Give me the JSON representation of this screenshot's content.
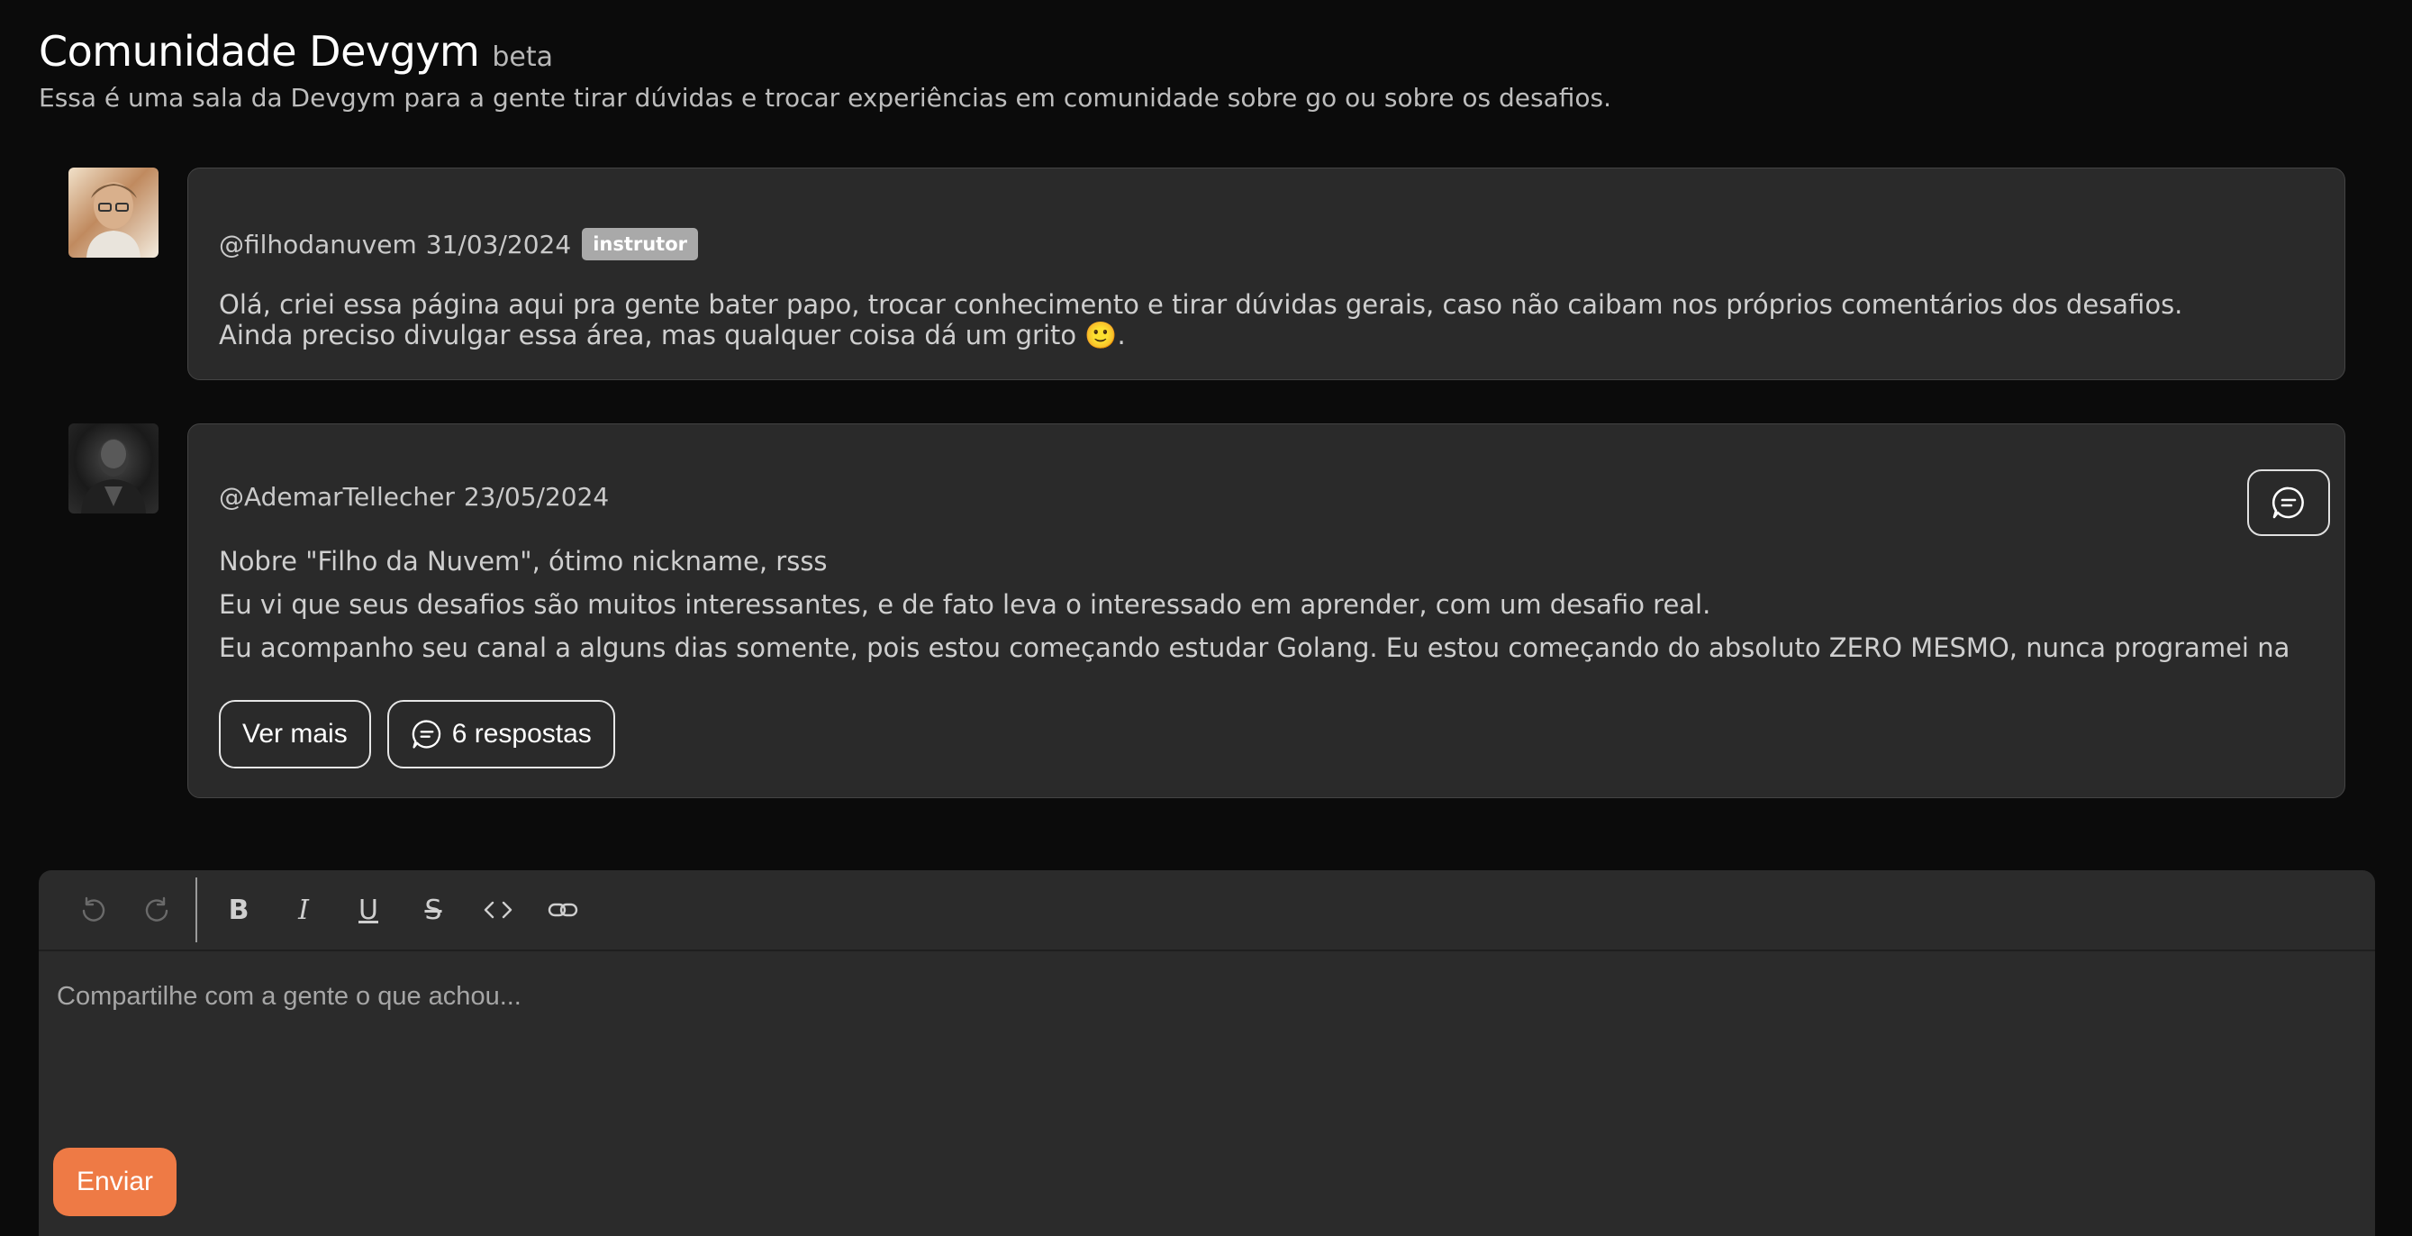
{
  "header": {
    "title": "Comunidade Devgym",
    "badge": "beta",
    "subtitle": "Essa é uma sala da Devgym para a gente tirar dúvidas e trocar experiências em comunidade sobre go ou sobre os desafios."
  },
  "posts": [
    {
      "author": "@filhodanuvem",
      "date": "31/03/2024",
      "role_badge": "instrutor",
      "lines": [
        "Olá, criei essa página aqui pra gente bater papo, trocar conhecimento e tirar dúvidas gerais, caso não caibam nos próprios comentários dos desafios.",
        "Ainda preciso divulgar essa área, mas qualquer coisa dá um grito 🙂."
      ]
    },
    {
      "author": "@AdemarTellecher",
      "date": "23/05/2024",
      "lines": [
        "Nobre \"Filho da Nuvem\", ótimo nickname, rsss",
        "Eu vi que seus desafios são muitos interessantes, e de fato leva o interessado em aprender, com um desafio real.",
        "Eu acompanho seu canal a alguns dias somente, pois estou começando estudar Golang. Eu estou começando do absoluto ZERO MESMO, nunca programei na"
      ],
      "see_more_label": "Ver mais",
      "replies_label": "6 respostas"
    }
  ],
  "editor": {
    "placeholder": "Compartilhe com a gente o que achou...",
    "value": "",
    "toolbar": {
      "bold": "B",
      "italic": "I",
      "underline": "U",
      "strike": "S"
    },
    "send_label": "Enviar"
  },
  "colors": {
    "background": "#0b0b0b",
    "card": "#2a2a2a",
    "accent": "#ee7a45",
    "badge": "#a9a9a9"
  },
  "icons": [
    "undo-icon",
    "redo-icon",
    "code-icon",
    "link-icon",
    "chat-bubble-icon"
  ]
}
